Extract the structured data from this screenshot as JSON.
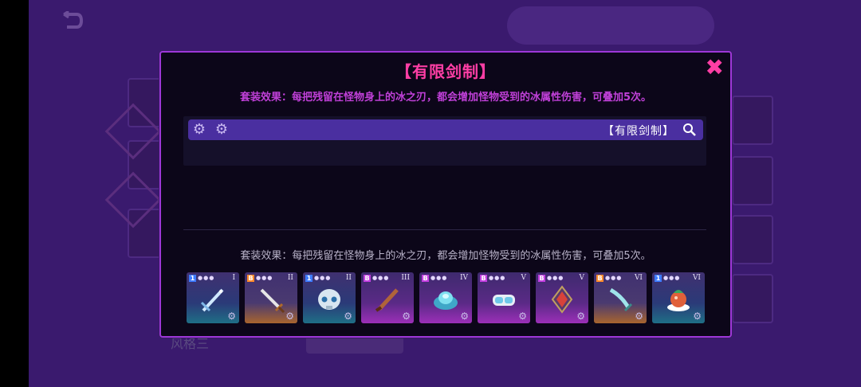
{
  "background": {
    "bottom_left_text": "风格三",
    "bottom_center_text": "",
    "bottom_right_text": ""
  },
  "dialog": {
    "title": "【有限剑制】",
    "subtitle": "套装效果：每把残留在怪物身上的冰之刃，都会增加怪物受到的冰属性伤害，可叠加5次。",
    "close_symbol": "✖",
    "search_bar": {
      "label": "【有限剑制】",
      "gear_count": 2
    },
    "effect_text": "套装效果：每把残留在怪物身上的冰之刃，都会增加怪物受到的冰属性伤害，可叠加5次。",
    "items": [
      {
        "roman": "I",
        "rarity": "blue",
        "icon": "ice-sword-icon"
      },
      {
        "roman": "II",
        "rarity": "orange",
        "icon": "dagger-icon"
      },
      {
        "roman": "II",
        "rarity": "blue",
        "icon": "skull-mask-icon"
      },
      {
        "roman": "III",
        "rarity": "purple",
        "icon": "bronze-blade-icon"
      },
      {
        "roman": "IV",
        "rarity": "purple",
        "icon": "ice-crystal-helm-icon"
      },
      {
        "roman": "V",
        "rarity": "purple",
        "icon": "goggles-icon"
      },
      {
        "roman": "V",
        "rarity": "purple",
        "icon": "red-gem-amulet-icon"
      },
      {
        "roman": "VI",
        "rarity": "orange",
        "icon": "curved-ice-blade-icon"
      },
      {
        "roman": "VI",
        "rarity": "blue",
        "icon": "potion-cake-icon"
      }
    ]
  },
  "colors": {
    "title": "#ff3ea5",
    "subtitle": "#c040d8",
    "dialog_border": "#9d37d8",
    "search_bar": "#4a2fa0"
  }
}
